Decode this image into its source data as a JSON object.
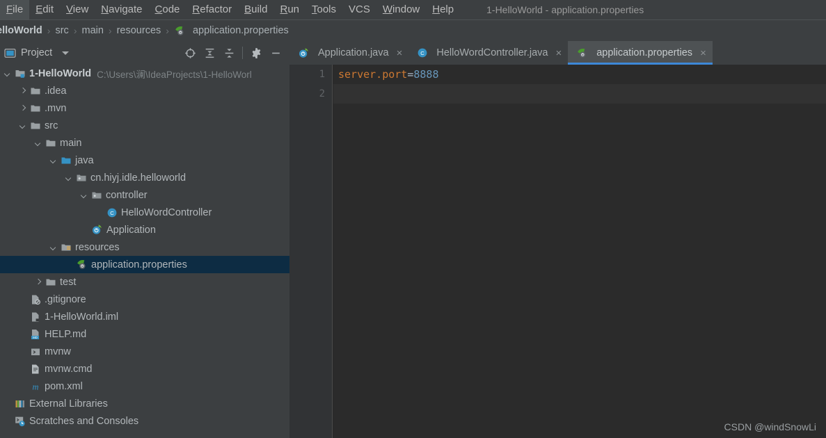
{
  "window": {
    "title": "1-HelloWorld - application.properties"
  },
  "menubar": {
    "items": [
      {
        "label": "File",
        "mnemonic": "F"
      },
      {
        "label": "Edit",
        "mnemonic": "E"
      },
      {
        "label": "View",
        "mnemonic": "V"
      },
      {
        "label": "Navigate",
        "mnemonic": "N"
      },
      {
        "label": "Code",
        "mnemonic": "C"
      },
      {
        "label": "Refactor",
        "mnemonic": "R"
      },
      {
        "label": "Build",
        "mnemonic": "B"
      },
      {
        "label": "Run",
        "mnemonic": "R"
      },
      {
        "label": "Tools",
        "mnemonic": "T"
      },
      {
        "label": "VCS",
        "mnemonic": ""
      },
      {
        "label": "Window",
        "mnemonic": "W"
      },
      {
        "label": "Help",
        "mnemonic": "H"
      }
    ]
  },
  "breadcrumb": {
    "separator": "›",
    "items": [
      {
        "label": "elloWorld",
        "icon": "none",
        "root": true
      },
      {
        "label": "src",
        "icon": "none",
        "root": false
      },
      {
        "label": "main",
        "icon": "none",
        "root": false
      },
      {
        "label": "resources",
        "icon": "none",
        "root": false
      },
      {
        "label": "application.properties",
        "icon": "spring-leaf-icon",
        "root": false
      }
    ]
  },
  "project_panel": {
    "title": "Project",
    "tools": [
      {
        "name": "locate-icon",
        "tooltip": "Select Opened File"
      },
      {
        "name": "expand-all-icon",
        "tooltip": "Expand All"
      },
      {
        "name": "collapse-all-icon",
        "tooltip": "Collapse All"
      },
      {
        "name": "gear-icon",
        "tooltip": "Settings"
      },
      {
        "name": "minimize-icon",
        "tooltip": "Hide"
      }
    ],
    "tree": [
      {
        "label": "1-HelloWorld",
        "path": "C:\\Users\\澜\\IdeaProjects\\1-HelloWorl",
        "indent": 0,
        "arrow": "down",
        "icon": "project-module-icon",
        "bold": true,
        "selected": false
      },
      {
        "label": ".idea",
        "path": "",
        "indent": 1,
        "arrow": "right",
        "icon": "folder-icon",
        "bold": false,
        "selected": false
      },
      {
        "label": ".mvn",
        "path": "",
        "indent": 1,
        "arrow": "right",
        "icon": "folder-icon",
        "bold": false,
        "selected": false
      },
      {
        "label": "src",
        "path": "",
        "indent": 1,
        "arrow": "down",
        "icon": "folder-icon",
        "bold": false,
        "selected": false
      },
      {
        "label": "main",
        "path": "",
        "indent": 2,
        "arrow": "down",
        "icon": "folder-icon",
        "bold": false,
        "selected": false
      },
      {
        "label": "java",
        "path": "",
        "indent": 3,
        "arrow": "down",
        "icon": "source-root-icon",
        "bold": false,
        "selected": false
      },
      {
        "label": "cn.hiyj.idle.helloworld",
        "path": "",
        "indent": 4,
        "arrow": "down",
        "icon": "package-icon",
        "bold": false,
        "selected": false
      },
      {
        "label": "controller",
        "path": "",
        "indent": 5,
        "arrow": "down",
        "icon": "package-icon",
        "bold": false,
        "selected": false
      },
      {
        "label": "HelloWordController",
        "path": "",
        "indent": 6,
        "arrow": "none",
        "icon": "java-class-icon",
        "bold": false,
        "selected": false
      },
      {
        "label": "Application",
        "path": "",
        "indent": 5,
        "arrow": "none",
        "icon": "spring-boot-run-icon",
        "bold": false,
        "selected": false
      },
      {
        "label": "resources",
        "path": "",
        "indent": 3,
        "arrow": "down",
        "icon": "resource-root-icon",
        "bold": false,
        "selected": false
      },
      {
        "label": "application.properties",
        "path": "",
        "indent": 4,
        "arrow": "none",
        "icon": "spring-leaf-icon",
        "bold": false,
        "selected": true
      },
      {
        "label": "test",
        "path": "",
        "indent": 2,
        "arrow": "right",
        "icon": "folder-icon",
        "bold": false,
        "selected": false
      },
      {
        "label": ".gitignore",
        "path": "",
        "indent": 1,
        "arrow": "none",
        "icon": "gitignore-icon",
        "bold": false,
        "selected": false
      },
      {
        "label": "1-HelloWorld.iml",
        "path": "",
        "indent": 1,
        "arrow": "none",
        "icon": "iml-icon",
        "bold": false,
        "selected": false
      },
      {
        "label": "HELP.md",
        "path": "",
        "indent": 1,
        "arrow": "none",
        "icon": "markdown-icon",
        "bold": false,
        "selected": false
      },
      {
        "label": "mvnw",
        "path": "",
        "indent": 1,
        "arrow": "none",
        "icon": "shell-script-icon",
        "bold": false,
        "selected": false
      },
      {
        "label": "mvnw.cmd",
        "path": "",
        "indent": 1,
        "arrow": "none",
        "icon": "cmd-script-icon",
        "bold": false,
        "selected": false
      },
      {
        "label": "pom.xml",
        "path": "",
        "indent": 1,
        "arrow": "none",
        "icon": "maven-icon",
        "bold": false,
        "selected": false
      },
      {
        "label": "External Libraries",
        "path": "",
        "indent": 0,
        "arrow": "none",
        "icon": "libraries-icon",
        "bold": false,
        "selected": false
      },
      {
        "label": "Scratches and Consoles",
        "path": "",
        "indent": 0,
        "arrow": "none",
        "icon": "scratches-icon",
        "bold": false,
        "selected": false
      }
    ]
  },
  "editor": {
    "tabs": [
      {
        "label": "Application.java",
        "icon": "spring-boot-run-icon",
        "active": false,
        "close": "×"
      },
      {
        "label": "HelloWordController.java",
        "icon": "java-class-icon",
        "active": false,
        "close": "×"
      },
      {
        "label": "application.properties",
        "icon": "spring-leaf-icon",
        "active": true,
        "close": "×"
      }
    ],
    "line_numbers": [
      "1",
      "2"
    ],
    "lines": [
      {
        "key": "server.port",
        "eq": "=",
        "value": "8888"
      },
      {
        "key": "",
        "eq": "",
        "value": ""
      }
    ]
  },
  "watermark": {
    "text": "CSDN @windSnowLi"
  },
  "colors": {
    "chrome_bg": "#3c3f41",
    "editor_bg": "#2b2b2b",
    "gutter_bg": "#313335",
    "selection": "#0d2c43",
    "tab_active_bg": "#4e5254",
    "tab_underline": "#3d88d8",
    "key_orange": "#cc7832",
    "value_blue": "#6897bb",
    "text": "#b2b7ba"
  }
}
